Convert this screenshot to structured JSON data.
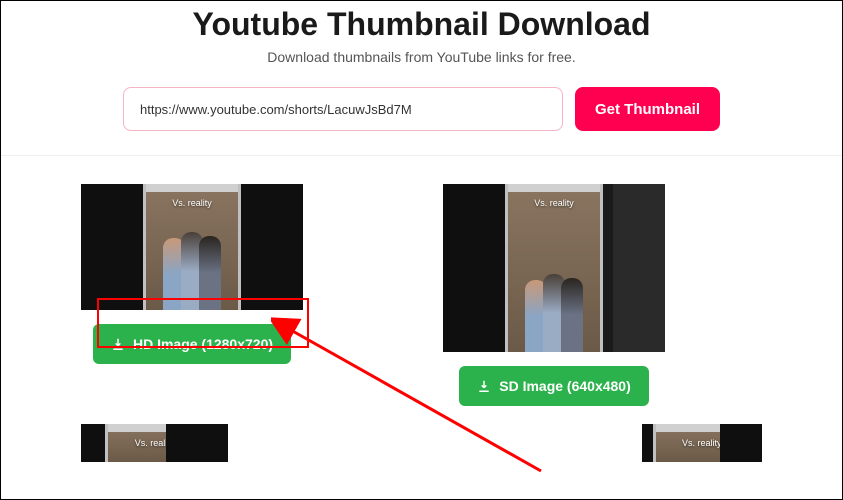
{
  "header": {
    "title": "Youtube Thumbnail Download",
    "subtitle": "Download thumbnails from YouTube links for free."
  },
  "search": {
    "url_value": "https://www.youtube.com/shorts/LacuwJsBd7M",
    "button_label": "Get Thumbnail"
  },
  "thumbnail_overlay": "Vs. reality",
  "results": [
    {
      "label": "HD Image (1280x720)"
    },
    {
      "label": "SD Image (640x480)"
    }
  ]
}
